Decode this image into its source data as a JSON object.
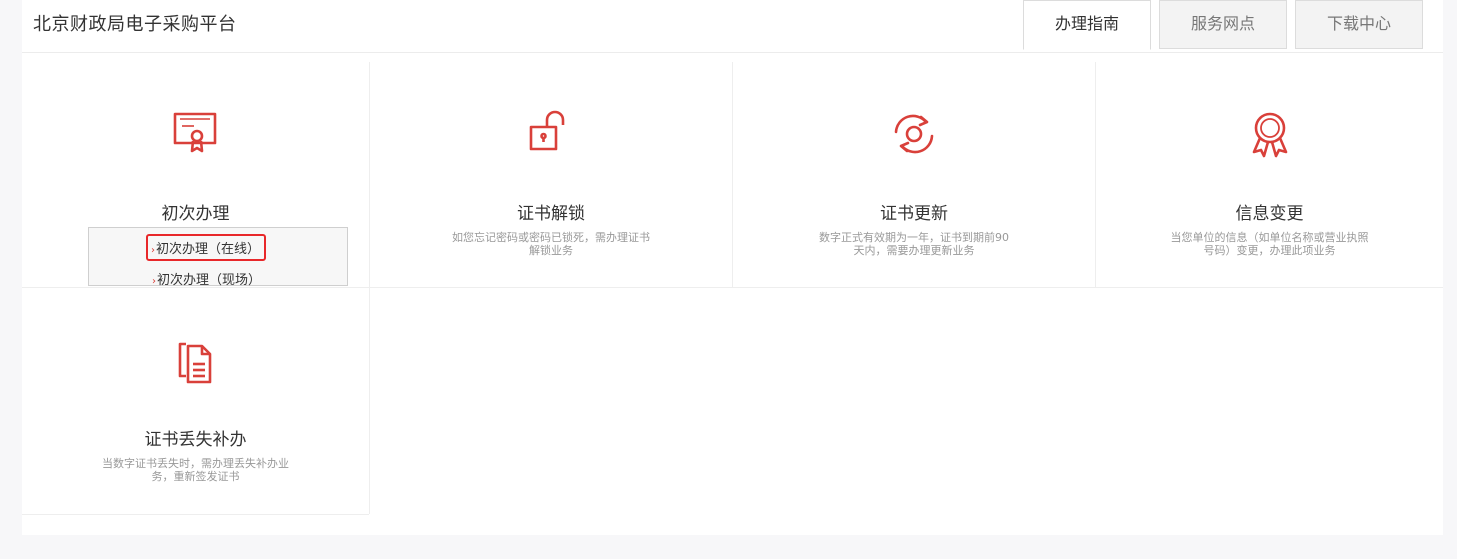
{
  "header": {
    "title": "北京财政局电子采购平台",
    "tabs": [
      {
        "label": "办理指南",
        "active": true
      },
      {
        "label": "服务网点",
        "active": false
      },
      {
        "label": "下载中心",
        "active": false
      }
    ]
  },
  "cards": [
    {
      "title": "初次办理",
      "description": "",
      "icon": "certificate-icon"
    },
    {
      "title": "证书解锁",
      "description": "如您忘记密码或密码已锁死，需办理证书解锁业务",
      "icon": "unlock-icon"
    },
    {
      "title": "证书更新",
      "description": "数字正式有效期为一年，证书到期前90天内，需要办理更新业务",
      "icon": "refresh-icon"
    },
    {
      "title": "信息变更",
      "description": "当您单位的信息（如单位名称或营业执照号码）变更，办理此项业务",
      "icon": "award-ribbon-icon"
    },
    {
      "title": "证书丢失补办",
      "description": "当数字证书丢失时，需办理丢失补办业务，重新签发证书",
      "icon": "document-copy-icon"
    }
  ],
  "dropdown": {
    "items": [
      {
        "label": "初次办理（在线）",
        "highlighted": true
      },
      {
        "label": "初次办理（现场）",
        "highlighted": false
      }
    ],
    "arrow_glyph": "›"
  },
  "colors": {
    "accent": "#d9403a",
    "highlight_border": "#e8282a",
    "text": "#333333",
    "muted": "#999999"
  }
}
